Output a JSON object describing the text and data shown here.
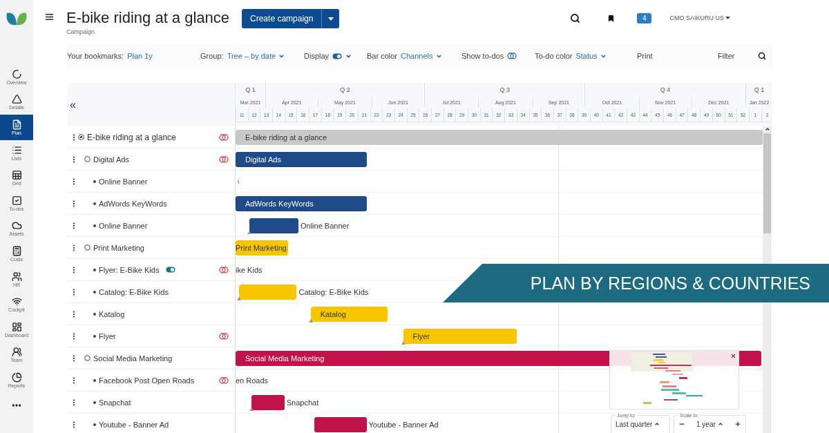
{
  "sidebar": {
    "items": [
      {
        "label": "Overview",
        "selected": false
      },
      {
        "label": "Details",
        "selected": false
      },
      {
        "label": "Plan",
        "selected": true
      },
      {
        "label": "Lists",
        "selected": false
      },
      {
        "label": "Grid",
        "selected": false
      },
      {
        "label": "To-dos",
        "selected": false
      },
      {
        "label": "Assets",
        "selected": false
      },
      {
        "label": "Costs",
        "selected": false
      },
      {
        "label": "HR",
        "selected": false
      },
      {
        "label": "Cockpit",
        "selected": false
      },
      {
        "label": "Dashboard",
        "selected": false
      },
      {
        "label": "Team",
        "selected": false
      },
      {
        "label": "Reports",
        "selected": false
      }
    ]
  },
  "header": {
    "title": "E-bike riding at a glance",
    "subtitle": "Campaign",
    "create_button": "Create campaign",
    "badge": "4",
    "user": "CMO SAIKURU US"
  },
  "toolbar": {
    "bookmarks_label": "Your bookmarks:",
    "bookmark": "Plan 1y",
    "group_label": "Group:",
    "group_value": "Tree – by date",
    "display_label": "Display",
    "display_on": true,
    "bar_color_label": "Bar color",
    "bar_color_value": "Channels",
    "show_todos_label": "Show to-dos",
    "show_todos_on": false,
    "todo_color_label": "To-do color",
    "todo_color_value": "Status",
    "print": "Print",
    "filter": "Filter"
  },
  "gantt": {
    "collapse": "«",
    "quarters": [
      "Q 1",
      "Q 2",
      "Q 3",
      "Q 4",
      "Q 1"
    ],
    "months": [
      "Mar 2021",
      "Apr 2021",
      "May 2021",
      "Jun 2021",
      "Jul 2021",
      "Aug 2021",
      "Sep 2021",
      "Oct 2021",
      "Nov 2021",
      "Dec 2021",
      "Jan 2022"
    ],
    "weeks": [
      "11",
      "12",
      "13",
      "14",
      "15",
      "16",
      "17",
      "18",
      "19",
      "20",
      "21",
      "22",
      "23",
      "24",
      "25",
      "26",
      "27",
      "28",
      "29",
      "30",
      "31",
      "32",
      "33",
      "34",
      "35",
      "36",
      "37",
      "38",
      "39",
      "40",
      "41",
      "42",
      "43",
      "44",
      "45",
      "46",
      "47",
      "48",
      "49",
      "50",
      "51",
      "52",
      "1",
      "2"
    ],
    "rows": [
      {
        "name": "E-bike riding at a glance",
        "kind": "campaign",
        "warning": true,
        "switch_on": false,
        "bar": {
          "label": "E-bike riding at a glance",
          "color": "#c9c9c9",
          "kind": "inside",
          "milestone": false
        },
        "children": [
          {
            "name": "Digital Ads",
            "kind": "group",
            "warning": true,
            "switch_on": false,
            "bar": {
              "label": "Digital Ads",
              "color": "#1f4a8a",
              "kind": "inside",
              "milestone": false
            },
            "children": [
              {
                "name": "Online Banner",
                "kind": "item",
                "warning": false,
                "switch_on": false
              },
              {
                "name": "AdWords KeyWords",
                "kind": "item",
                "warning": false,
                "switch_on": false,
                "bar": {
                  "label": "AdWords KeyWords",
                  "color": "#1f4a8a",
                  "kind": "inside",
                  "milestone": false
                }
              },
              {
                "name": "Online Banner",
                "kind": "item",
                "warning": false,
                "switch_on": false,
                "bar": {
                  "label": "Online Banner",
                  "color": "#1f4a8a",
                  "kind": "outside",
                  "milestone": true
                }
              }
            ]
          },
          {
            "name": "Print Marketing",
            "kind": "group",
            "warning": false,
            "switch_on": false,
            "bar": {
              "label": "Print Marketing",
              "color": "#f7c600",
              "kind": "inside",
              "milestone": false
            },
            "children": [
              {
                "name": "Flyer: E-Bike Kids",
                "kind": "item",
                "warning": true,
                "switch_on": true,
                "bar": {
                  "label": "ike Kids",
                  "kind": "outside",
                  "milestone": false
                }
              },
              {
                "name": "Catalog: E-Bike Kids",
                "kind": "item",
                "warning": false,
                "switch_on": false,
                "bar": {
                  "label": "Catalog: E-Bike Kids",
                  "color": "#f7c600",
                  "kind": "outside",
                  "milestone": true
                }
              },
              {
                "name": "Katalog",
                "kind": "item",
                "warning": false,
                "switch_on": false,
                "bar": {
                  "label": "Katalog",
                  "color": "#f7c600",
                  "kind": "inside",
                  "milestone": true
                }
              },
              {
                "name": "Flyer",
                "kind": "item",
                "warning": true,
                "switch_on": false,
                "bar": {
                  "label": "Flyer",
                  "color": "#f7c600",
                  "kind": "inside",
                  "milestone": true
                }
              }
            ]
          },
          {
            "name": "Social Media Marketing",
            "kind": "group",
            "warning": false,
            "switch_on": false,
            "bar": {
              "label": "Social Media Marketing",
              "color": "#c2124a",
              "kind": "inside",
              "milestone": false
            },
            "children": [
              {
                "name": "Facebook Post Open Roads",
                "kind": "item",
                "warning": true,
                "switch_on": false,
                "bar": {
                  "label": "en Roads",
                  "kind": "outside",
                  "milestone": false
                }
              },
              {
                "name": "Snapchat",
                "kind": "item",
                "warning": false,
                "switch_on": false,
                "bar": {
                  "label": "Snapchat",
                  "color": "#c2124a",
                  "kind": "outside",
                  "milestone": true
                }
              },
              {
                "name": "Youtube - Banner Ad",
                "kind": "item",
                "warning": false,
                "switch_on": false,
                "bar": {
                  "label": "Youtube - Banner Ad",
                  "color": "#c2124a",
                  "kind": "outside",
                  "milestone": false
                }
              }
            ]
          }
        ]
      }
    ]
  },
  "minimap": {
    "jump_label": "Jump to:",
    "jump_value": "Last quarter",
    "scale_label": "Scale to:",
    "scale_value": "1 year"
  },
  "banner": {
    "text": "PLAN BY REGIONS & COUNTRIES"
  }
}
